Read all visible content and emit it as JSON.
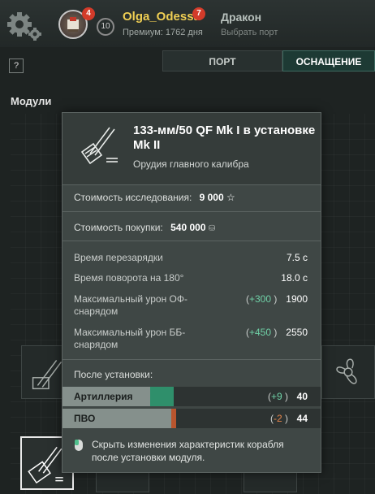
{
  "header": {
    "notifications_count": "4",
    "level": "10",
    "username": "Olga_Odessa",
    "username_badge": "7",
    "premium": "Премиум: 1762 дня",
    "ship_name": "Дракон",
    "select_port": "Выбрать порт"
  },
  "help_label": "?",
  "tabs": [
    {
      "label": "ПОРТ",
      "active": false
    },
    {
      "label": "ОСНАЩЕНИЕ",
      "active": true
    }
  ],
  "section_title": "Модули",
  "tooltip": {
    "name": "133-мм/50 QF Mk I в установке Mk II",
    "subtitle": "Орудия главного калибра",
    "research_cost_label": "Стоимость исследования:",
    "research_cost_value": "9 000",
    "research_cost_icon": "star-icon",
    "purchase_cost_label": "Стоимость покупки:",
    "purchase_cost_value": "540 000",
    "purchase_cost_icon": "credits-icon",
    "stats": [
      {
        "label": "Время перезарядки",
        "delta": "",
        "value": "7.5 с"
      },
      {
        "label": "Время поворота на 180°",
        "delta": "",
        "value": "18.0 с"
      },
      {
        "label": "Максимальный урон ОФ-снарядом",
        "delta": "+300",
        "value": "1900"
      },
      {
        "label": "Максимальный урон ББ-снарядом",
        "delta": "+450",
        "value": "2550"
      }
    ],
    "after_install_label": "После установки:",
    "bars": [
      {
        "label": "Артиллерия",
        "base": 0.34,
        "delta": 0.09,
        "delta_text": "+9",
        "value": "40",
        "delta_color": "#2f8f6b"
      },
      {
        "label": "ПВО",
        "base": 0.44,
        "delta": -0.02,
        "delta_text": "-2",
        "value": "44",
        "delta_color": "#b9552e"
      }
    ],
    "hint": "Скрыть изменения характеристик корабля после установки модуля."
  },
  "colors": {
    "accent_gold": "#f0cf54",
    "positive": "#6fd0a6",
    "negative": "#e4854b",
    "badge_red": "#d33b2a"
  }
}
